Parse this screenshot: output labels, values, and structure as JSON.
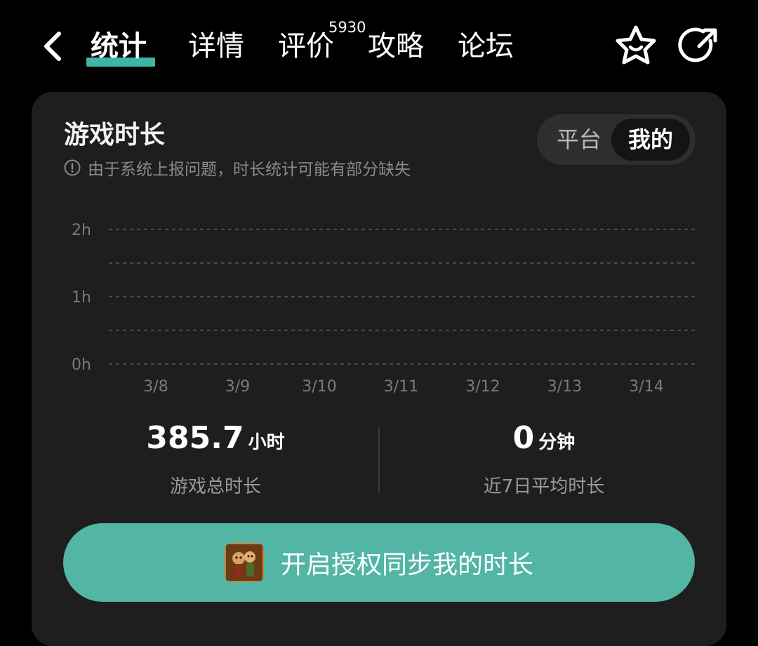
{
  "nav": {
    "back_icon": "chevron-left-icon",
    "tabs": [
      {
        "label": "统计",
        "active": true
      },
      {
        "label": "详情",
        "active": false
      },
      {
        "label": "评价",
        "active": false,
        "badge": "5930"
      },
      {
        "label": "攻略",
        "active": false
      },
      {
        "label": "论坛",
        "active": false
      }
    ],
    "accent_color": "#3fb5a3",
    "favorite_icon": "star-smile-icon",
    "share_icon": "share-icon"
  },
  "card": {
    "title": "游戏时长",
    "notice": "由于系统上报问题，时长统计可能有部分缺失",
    "notice_icon": "info-circle-icon",
    "toggle": {
      "options": [
        "平台",
        "我的"
      ],
      "selected": "我的"
    }
  },
  "chart_data": {
    "type": "bar",
    "categories": [
      "3/8",
      "3/9",
      "3/10",
      "3/11",
      "3/12",
      "3/13",
      "3/14"
    ],
    "values": [
      0,
      0,
      0,
      0,
      0,
      0,
      0
    ],
    "y_tick_labels": [
      "0h",
      "1h",
      "2h"
    ],
    "ylim": [
      0,
      2
    ],
    "grid": true,
    "grid_style": "dashed"
  },
  "stats": {
    "total": {
      "value": "385.7",
      "unit": "小时",
      "label": "游戏总时长"
    },
    "recent": {
      "value": "0",
      "unit": "分钟",
      "label": "近7日平均时长"
    }
  },
  "sync_button": {
    "label": "开启授权同步我的时长",
    "color": "#52b5a6",
    "icon": "game-app-icon"
  }
}
